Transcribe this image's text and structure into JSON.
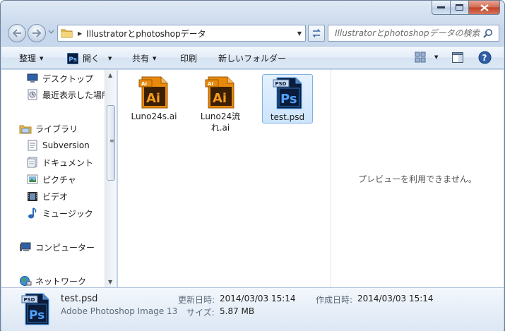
{
  "window": {
    "caption_buttons": [
      "minimize",
      "maximize",
      "close"
    ]
  },
  "address": {
    "path": "Illustratorとphotoshopデータ",
    "search_placeholder": "Illustratorとphotoshopデータの検索"
  },
  "toolbar": {
    "organize": "整理",
    "open": "開く",
    "share": "共有",
    "print": "印刷",
    "new_folder": "新しいフォルダー"
  },
  "nav_tree": [
    {
      "label": "デスクトップ",
      "icon": "desktop-icon"
    },
    {
      "label": "最近表示した場所",
      "icon": "recent-places-icon"
    },
    {
      "label": "ライブラリ",
      "icon": "libraries-icon"
    },
    {
      "label": "Subversion",
      "icon": "document-library-icon"
    },
    {
      "label": "ドキュメント",
      "icon": "documents-icon"
    },
    {
      "label": "ピクチャ",
      "icon": "pictures-icon"
    },
    {
      "label": "ビデオ",
      "icon": "videos-icon"
    },
    {
      "label": "ミュージック",
      "icon": "music-icon"
    },
    {
      "label": "コンピューター",
      "icon": "computer-icon"
    },
    {
      "label": "ネットワーク",
      "icon": "network-icon"
    }
  ],
  "files": [
    {
      "name": "Luno24s.ai",
      "type": "ai",
      "badge": "Ai",
      "tag": "AI",
      "selected": false
    },
    {
      "name": "Luno24流れ.ai",
      "type": "ai",
      "badge": "Ai",
      "tag": "AI",
      "selected": false
    },
    {
      "name": "test.psd",
      "type": "psd",
      "badge": "Ps",
      "tag": "PSD",
      "selected": true
    }
  ],
  "preview": {
    "message": "プレビューを利用できません。"
  },
  "details": {
    "file_name": "test.psd",
    "file_type": "Adobe Photoshop Image 13",
    "modified_label": "更新日時:",
    "modified_value": "2014/03/03 15:14",
    "size_label": "サイズ:",
    "size_value": "5.87 MB",
    "created_label": "作成日時:",
    "created_value": "2014/03/03 15:14"
  },
  "colors": {
    "ai_orange": "#e8890c",
    "ai_dark": "#3b1f04",
    "ps_dark": "#0b1c3a",
    "ps_blue": "#4fa3ff",
    "selection_fill": "#cce4fb",
    "selection_border": "#7fb1e7"
  }
}
